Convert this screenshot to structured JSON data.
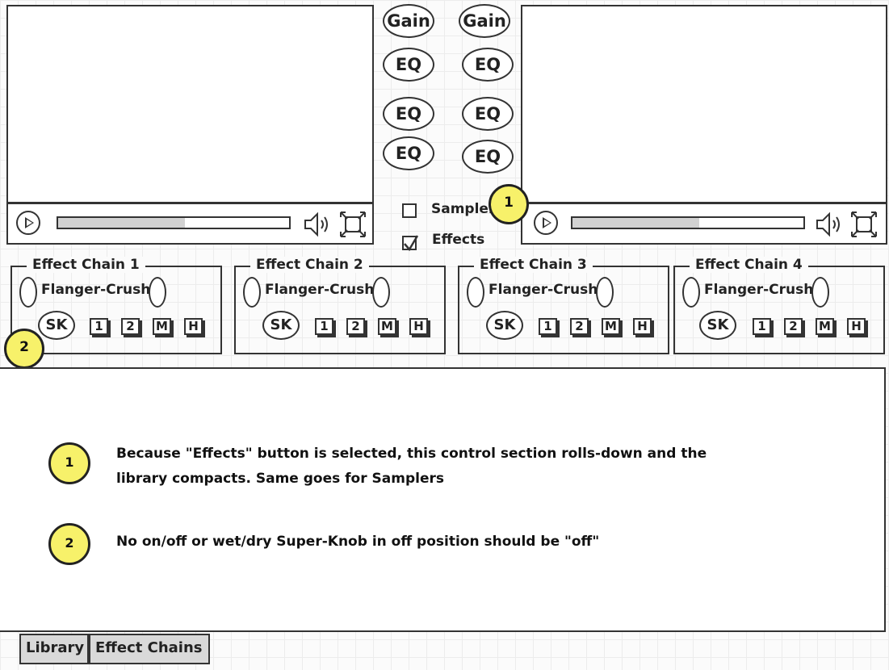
{
  "decks": [
    {
      "progress": 0.55
    },
    {
      "progress": 0.55
    }
  ],
  "knobs": {
    "gain_label": "Gain",
    "eq_label": "EQ"
  },
  "toggles": {
    "samplers_label": "Samplers",
    "samplers_checked": false,
    "effects_label": "Effects",
    "effects_checked": true
  },
  "effect_chains": [
    {
      "title": "Effect Chain 1",
      "preset": "Flanger-Crush",
      "superknob": "SK",
      "buttons": [
        "1",
        "2",
        "M",
        "H"
      ]
    },
    {
      "title": "Effect Chain 2",
      "preset": "Flanger-Crush",
      "superknob": "SK",
      "buttons": [
        "1",
        "2",
        "M",
        "H"
      ]
    },
    {
      "title": "Effect Chain 3",
      "preset": "Flanger-Crush",
      "superknob": "SK",
      "buttons": [
        "1",
        "2",
        "M",
        "H"
      ]
    },
    {
      "title": "Effect Chain 4",
      "preset": "Flanger-Crush",
      "superknob": "SK",
      "buttons": [
        "1",
        "2",
        "M",
        "H"
      ]
    }
  ],
  "callouts": {
    "one": "1",
    "two": "2"
  },
  "notes": [
    {
      "number": "1",
      "text": "Because \"Effects\" button is selected, this control section rolls-down and the library compacts. Same goes for Samplers"
    },
    {
      "number": "2",
      "text": "No on/off or wet/dry  Super-Knob in off position should be \"off\""
    }
  ],
  "tabs": {
    "library": "Library",
    "effect_chains": "Effect Chains"
  },
  "colors": {
    "callout": "#f7f16a",
    "progress_fill": "#d2d2d2",
    "tab_fill": "#d9d9d9"
  }
}
